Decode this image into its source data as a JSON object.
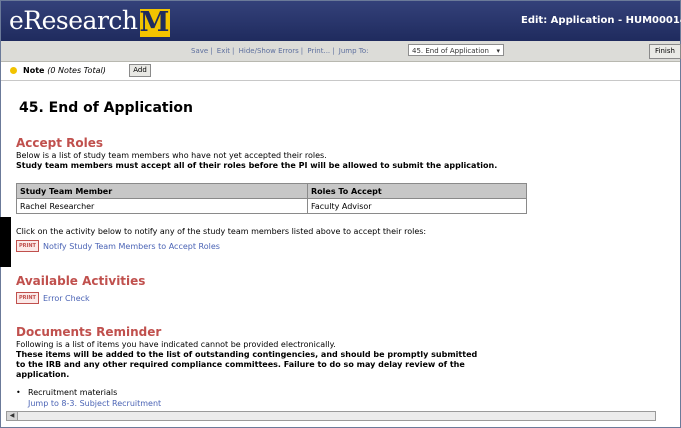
{
  "header": {
    "logo_text": "eResearch",
    "logo_m": "M",
    "edit_title": "Edit: Application - HUM0001440"
  },
  "toolbar": {
    "links": [
      "Save",
      "Exit",
      "Hide/Show Errors",
      "Print...",
      "Jump To:"
    ],
    "jump_value": "45. End of Application",
    "finish_label": "Finish"
  },
  "notes": {
    "label": "Note",
    "count": "(0 Notes Total)",
    "add_label": "Add"
  },
  "page": {
    "title": "45. End of Application"
  },
  "accept_roles": {
    "heading": "Accept Roles",
    "intro": "Below is a list of study team members who have not yet accepted their roles.",
    "warning": "Study team members must accept all of their roles before the PI will be allowed to submit the application.",
    "columns": [
      "Study Team Member",
      "Roles To Accept"
    ],
    "rows": [
      [
        "Rachel Researcher",
        "Faculty Advisor"
      ]
    ],
    "instruction": "Click on the activity below to notify any of the study team members listed above to accept their roles:",
    "activity_icon": "PRINT",
    "activity_label": "Notify Study Team Members to Accept Roles"
  },
  "available_activities": {
    "heading": "Available Activities",
    "activity_icon": "PRINT",
    "activity_label": "Error Check"
  },
  "documents_reminder": {
    "heading": "Documents Reminder",
    "intro": "Following is a list of items you have indicated cannot be provided electronically.",
    "warning_lines": [
      "These items will be added to the list of outstanding contingencies, and should be promptly submitted",
      "to the IRB and any other required compliance committees. Failure to do so may delay review of the",
      "application."
    ],
    "item": "Recruitment materials",
    "jump_link": "Jump to 8-3. Subject Recruitment"
  }
}
